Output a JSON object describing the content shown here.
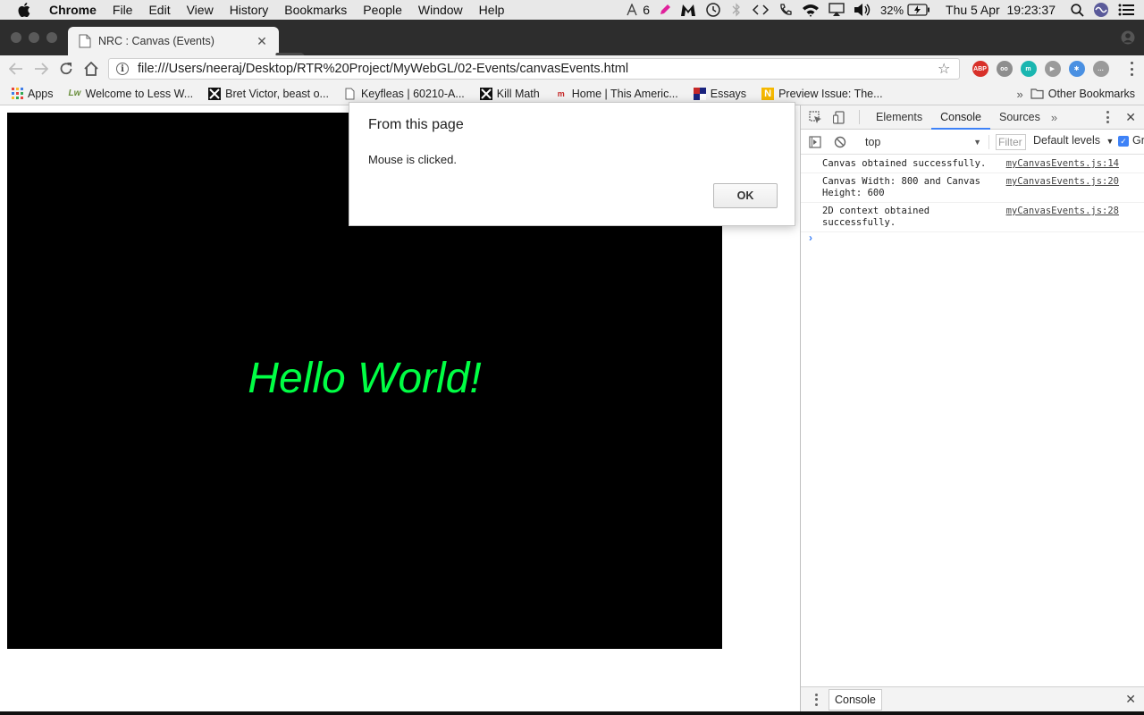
{
  "menubar": {
    "app_name": "Chrome",
    "menus": [
      "File",
      "Edit",
      "View",
      "History",
      "Bookmarks",
      "People",
      "Window",
      "Help"
    ],
    "status": {
      "notification_count": "6",
      "battery": "32%",
      "clock": "Thu 5 Apr  19:23:37"
    }
  },
  "tab": {
    "title": "NRC : Canvas (Events)",
    "close_label": "✕"
  },
  "toolbar": {
    "url": "file:///Users/neeraj/Desktop/RTR%20Project/MyWebGL/02-Events/canvasEvents.html",
    "info_glyph": "i",
    "star_glyph": "☆",
    "extensions": [
      {
        "name": "adblock-plus-icon",
        "label": "ABP",
        "color": "#d8312a"
      },
      {
        "name": "extension-eyes-icon",
        "label": "oo",
        "color": "#8e8e8e"
      },
      {
        "name": "extension-m-icon",
        "label": "m",
        "color": "#1ab6b0"
      },
      {
        "name": "extension-video-icon",
        "label": "▶",
        "color": "#9a9a9a"
      },
      {
        "name": "extension-snowflake-icon",
        "label": "✱",
        "color": "#4a90e2"
      },
      {
        "name": "extension-chat-icon",
        "label": "…",
        "color": "#9a9a9a"
      }
    ]
  },
  "bookmarks": {
    "items": [
      {
        "label": "Apps"
      },
      {
        "label": "Welcome to Less W..."
      },
      {
        "label": "Bret Victor, beast o..."
      },
      {
        "label": "Keyfleas | 60210-A..."
      },
      {
        "label": "Kill Math"
      },
      {
        "label": "Home | This Americ..."
      },
      {
        "label": "Essays"
      },
      {
        "label": "Preview Issue: The..."
      }
    ],
    "overflow_glyph": "»",
    "other_bookmarks": "Other Bookmarks"
  },
  "page": {
    "canvas_text": "Hello World!",
    "canvas_text_color": "#00ff44"
  },
  "alert": {
    "heading": "From this page",
    "message": "Mouse is clicked.",
    "ok_label": "OK"
  },
  "devtools": {
    "tabs": [
      "Elements",
      "Console",
      "Sources"
    ],
    "active_tab": "Console",
    "more_glyph": "»",
    "context": "top",
    "filter_placeholder": "Filter",
    "levels": "Default levels",
    "group_label": "Gr",
    "logs": [
      {
        "message": "Canvas obtained successfully.",
        "source": "myCanvasEvents.js:14"
      },
      {
        "message": "Canvas Width: 800 and Canvas\nHeight: 600",
        "source": "myCanvasEvents.js:20"
      },
      {
        "message": "2D context obtained\nsuccessfully.",
        "source": "myCanvasEvents.js:28"
      }
    ],
    "prompt_glyph": "›",
    "drawer_tab": "Console"
  }
}
